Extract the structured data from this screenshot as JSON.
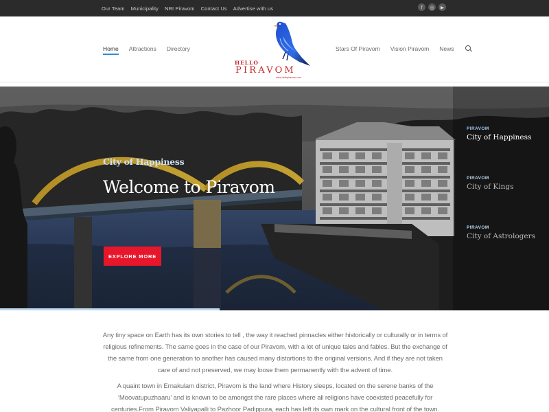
{
  "topbar": {
    "links": [
      "Our Team",
      "Municipality",
      "NRI Piravom",
      "Contact Us",
      "Advertise with us"
    ],
    "social_icons": [
      "facebook-icon",
      "instagram-icon",
      "youtube-icon"
    ],
    "social_glyphs": [
      "f",
      "◎",
      "▶"
    ]
  },
  "header": {
    "nav_left": [
      "Home",
      "Attractions",
      "Directory"
    ],
    "nav_right": [
      "Stars Of Piravom",
      "Vision Piravom",
      "News"
    ],
    "logo": {
      "hello": "HELLO",
      "name": "PIRAVOM",
      "url": "www.hellopiravom.com"
    }
  },
  "hero": {
    "subtitle": "City of Happiness",
    "title": "Welcome to Piravom",
    "button_label": "EXPLORE MORE",
    "slides": [
      {
        "tag": "PIRAVOM",
        "name": "City of Happiness",
        "active": true
      },
      {
        "tag": "PIRAVOM",
        "name": "City of Kings",
        "active": false
      },
      {
        "tag": "PIRAVOM",
        "name": "City of Astrologers",
        "active": false
      }
    ]
  },
  "content": {
    "paragraph1": "Any tiny space on Earth has its own stories to tell , the way it reached pinnacles either historically or culturally or in terms of religious refinements. The same goes in the case of our Piravom, with a lot of unique tales and fables. But the exchange of the same from one generation to another has caused many distortions to the original versions. And if they are not taken care of and not preserved, we may loose them permanently with the advent of time.",
    "paragraph2": "A quaint town in Ernakulam district, Piravom is the land where History sleeps, located on the serene banks of the ‘Moovatupuzhaaru’ and is known to be amongst the rare places where all religions have coexisted peacefully for centuries.From Piravom Valiyapalli to Pazhoor Padippura, each has left its own mark on the cultural front of the town. ‘Piravom’ – with its etymological origins from the word ‘Piravi’ or"
  },
  "colors": {
    "accent": "#2d8bd6",
    "button": "#e8162b",
    "brand": "#c2272d",
    "topbar": "#2b2b2b"
  }
}
